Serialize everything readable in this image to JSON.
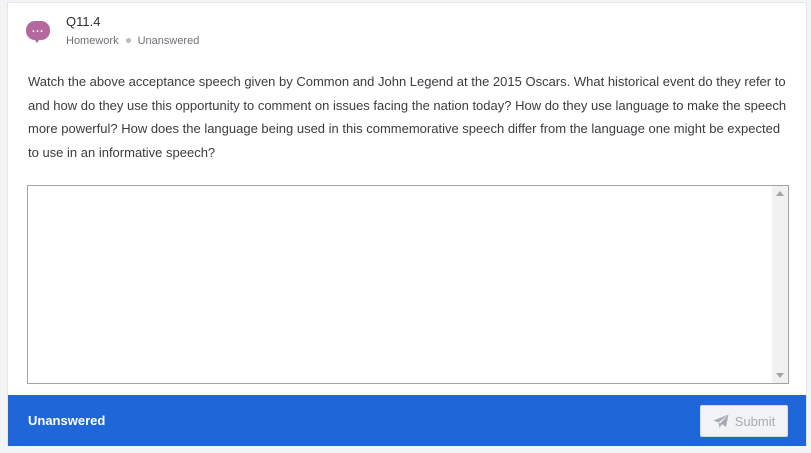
{
  "question": {
    "title": "Q11.4",
    "type": "Homework",
    "status": "Unanswered",
    "icon": "chat-bubble-icon",
    "text": "Watch the above acceptance speech given by Common and John Legend at the 2015 Oscars. What historical event do they refer to and how do they use this opportunity to comment on issues facing the nation today? How do they use language to make the speech more powerful? How does the language being used in this commemorative speech differ from the language one might be expected to use in an informative speech?"
  },
  "answer": {
    "value": "",
    "placeholder": ""
  },
  "footer": {
    "status_label": "Unanswered",
    "submit_label": "Submit",
    "submit_icon": "paper-plane-icon"
  },
  "colors": {
    "icon": "#b5689f",
    "footer_bg": "#1f67d9"
  }
}
